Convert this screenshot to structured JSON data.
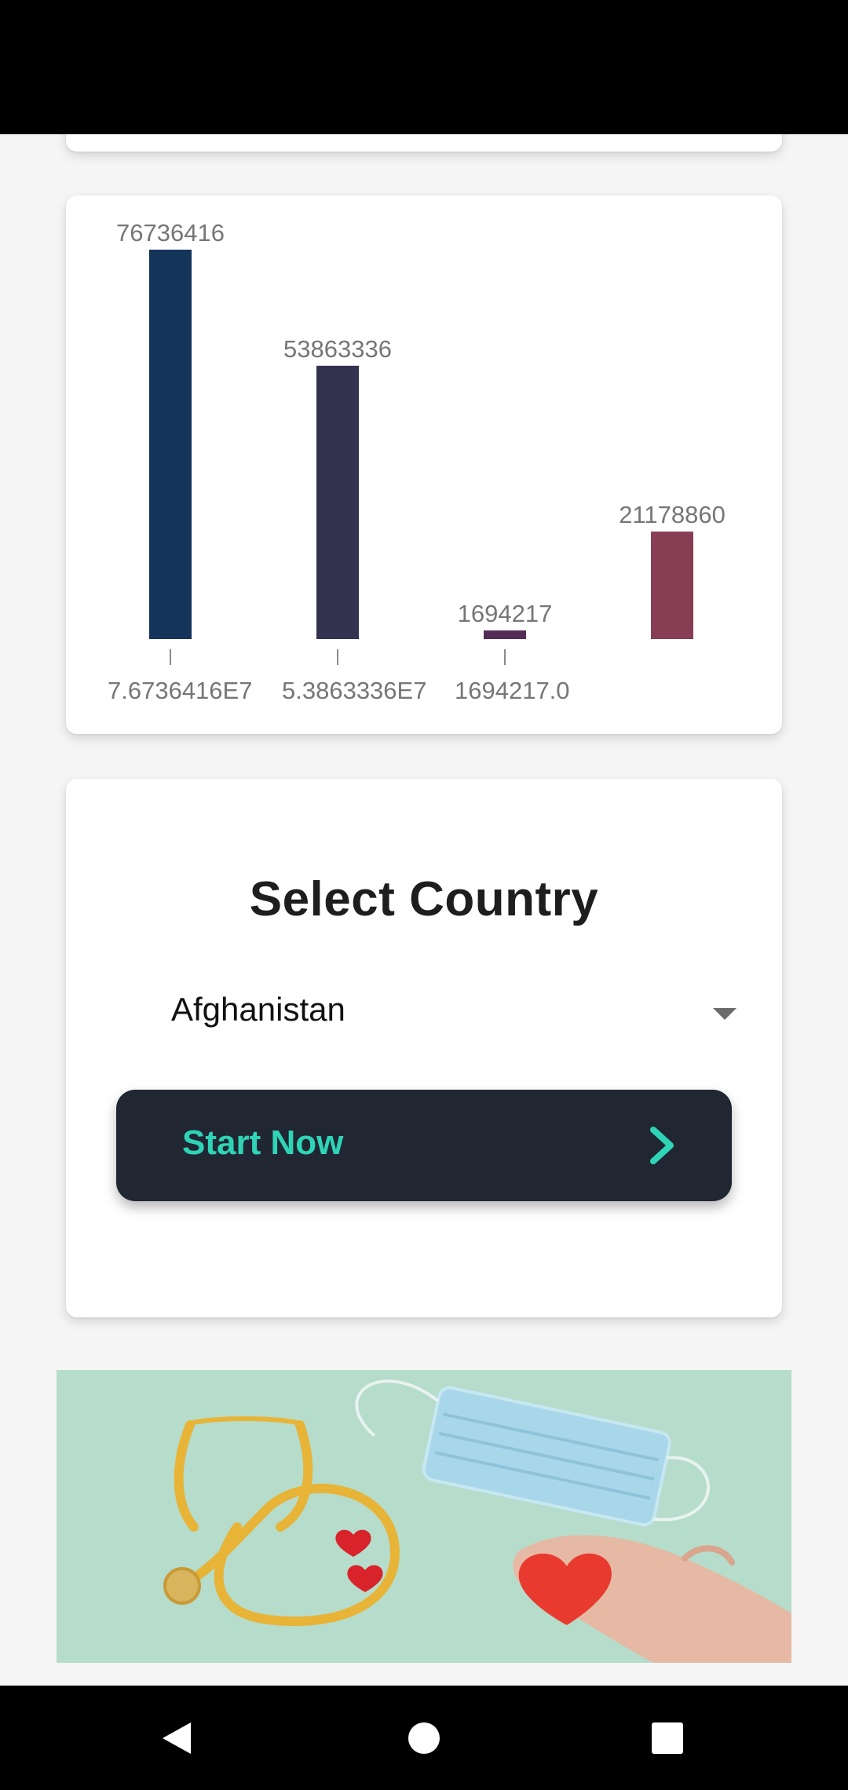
{
  "chart_data": {
    "type": "bar",
    "values": [
      76736416,
      53863336,
      1694217,
      21178860
    ],
    "value_labels": [
      "76736416",
      "53863336",
      "1694217",
      "21178860"
    ],
    "x_tick_labels": [
      "7.6736416E7",
      "5.3863336E7",
      "1694217.0"
    ],
    "colors": [
      "#14345a",
      "#33334f",
      "#532d57",
      "#873e54"
    ],
    "ylim": [
      0,
      76736416
    ]
  },
  "country_card": {
    "title": "Select Country",
    "selected_country": "Afghanistan",
    "start_button_label": "Start Now"
  },
  "banner": {
    "image_description_icon": "stethoscope-mask-hearts-image"
  },
  "icons": {
    "dropdown": "dropdown-arrow-icon",
    "start": "chevron-right-icon",
    "back": "back-icon",
    "home": "home-icon",
    "recent": "recent-apps-icon"
  }
}
